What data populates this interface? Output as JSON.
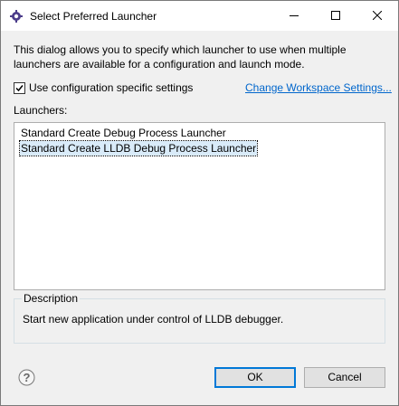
{
  "window": {
    "title": "Select Preferred Launcher"
  },
  "titlebar": {
    "icon": "eclipse-gear-icon",
    "controls": [
      "minimize-icon",
      "maximize-icon",
      "close-icon"
    ]
  },
  "description": "This dialog allows you to specify which launcher to use when multiple\nlaunchers are available for a configuration and launch mode.",
  "options": {
    "use_config_settings_label": "Use configuration specific settings",
    "use_config_settings_checked": true,
    "change_workspace_link": "Change Workspace Settings..."
  },
  "launchers": {
    "label": "Launchers:",
    "items": [
      {
        "label": "Standard Create Debug Process Launcher",
        "selected": false
      },
      {
        "label": "Standard Create LLDB Debug Process Launcher",
        "selected": true
      }
    ]
  },
  "description_group": {
    "title": "Description",
    "text": "Start new application under control of LLDB debugger."
  },
  "buttons": {
    "ok": "OK",
    "cancel": "Cancel",
    "help_icon": "help-icon"
  },
  "colors": {
    "link": "#0066cc",
    "default_button_border": "#0078d7",
    "selection_bg": "#d9ebf9"
  }
}
